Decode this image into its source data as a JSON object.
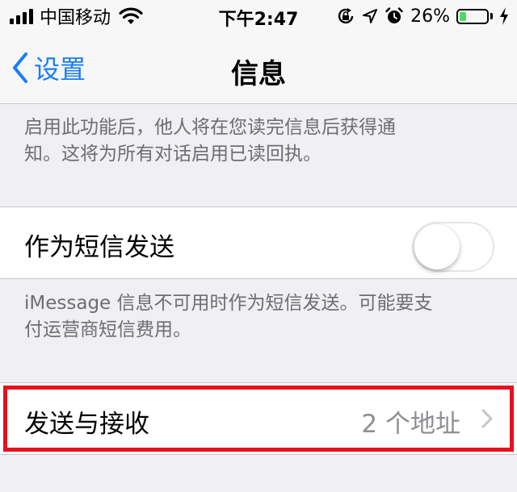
{
  "status_bar": {
    "carrier": "中国移动",
    "time": "下午2:47",
    "battery_percent": "26%",
    "battery_level": 0.26,
    "battery_color": "#4cd964",
    "icons": [
      "signal-bars-icon",
      "wifi-icon",
      "rotation-lock-icon",
      "location-arrow-icon",
      "alarm-icon",
      "battery-icon",
      "charging-bolt-icon"
    ]
  },
  "nav": {
    "back_label": "设置",
    "title": "信息",
    "accent_color": "#1a7ef5"
  },
  "read_receipts_note": {
    "line1": "启用此功能后，他人将在您读完信息后获得通",
    "line2": "知。这将为所有对话启用已读回执。"
  },
  "send_as_sms": {
    "label": "作为短信发送",
    "enabled": false
  },
  "send_as_sms_note": {
    "line1": "iMessage 信息不可用时作为短信发送。可能要支",
    "line2": "付运营商短信费用。"
  },
  "send_receive": {
    "label": "发送与接收",
    "detail": "2 个地址",
    "highlight_color": "#e8101c"
  }
}
